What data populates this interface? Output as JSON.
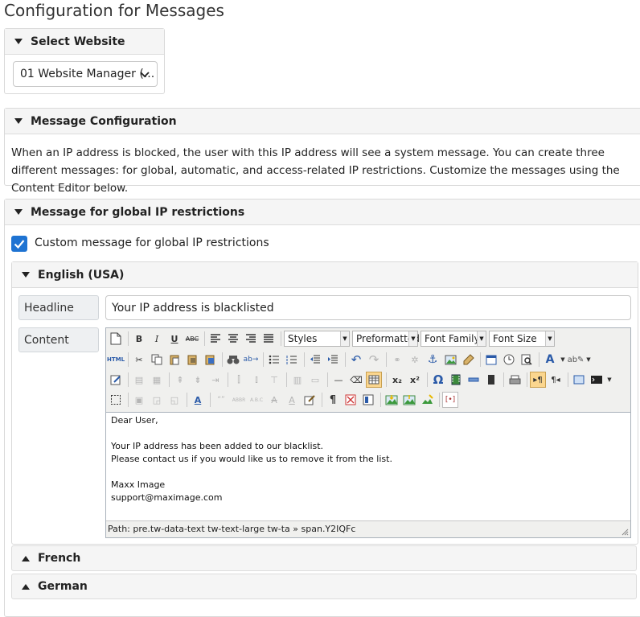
{
  "page": {
    "title": "Configuration for Messages"
  },
  "website": {
    "section_title": "Select Website",
    "selected": "01 Website Manager (..."
  },
  "message_config": {
    "section_title": "Message Configuration",
    "description": "When an IP address is blocked, the user with this IP address will see a system message. You can create three different messages: for global, automatic, and access-related IP restrictions. Customize the messages using the Content Editor below."
  },
  "global": {
    "section_title": "Message for global IP restrictions",
    "checkbox_label": "Custom message for global IP restrictions",
    "checkbox_checked": true,
    "languages": [
      {
        "name": "English (USA)",
        "expanded": true
      },
      {
        "name": "French",
        "expanded": false
      },
      {
        "name": "German",
        "expanded": false
      }
    ],
    "headline_label": "Headline",
    "headline_value": "Your IP address is blacklisted",
    "content_label": "Content",
    "editor": {
      "styles": "Styles",
      "format": "Preformatted",
      "font_family": "Font Family",
      "font_size": "Font Size",
      "lines": [
        "Dear User,",
        "",
        "Your IP address has been added to our blacklist.",
        "Please contact us if you would like us to remove it from the list.",
        "",
        "Maxx Image",
        "support@maximage.com"
      ],
      "path": "Path: pre.tw-data-text tw-text-large tw-ta » span.Y2IQFc"
    }
  },
  "colors": {
    "accent": "#1e73d2",
    "panel_header": "#f5f5f5",
    "border": "#d9d9d9"
  }
}
